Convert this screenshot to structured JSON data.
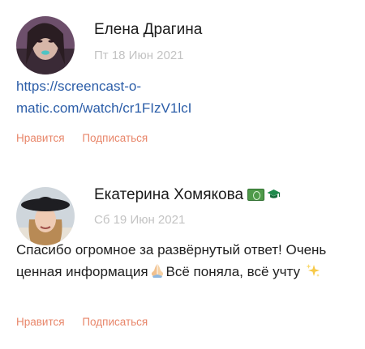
{
  "comments": [
    {
      "author": "Елена Драгина",
      "date": "Пт 18 Июн 2021",
      "text_lines": [
        "https://screencast-o-",
        "matic.com/watch/cr1FIzV1lcI"
      ],
      "like_label": "Нравится",
      "subscribe_label": "Подписаться"
    },
    {
      "author": "Екатерина Хомякова",
      "date": "Сб 19 Июн 2021",
      "text_part1": "Спасибо огромное за развёрнутый ответ! Очень ценная информация",
      "text_part2": "Всё поняла, всё учту",
      "like_label": "Нравится",
      "subscribe_label": "Подписаться"
    }
  ],
  "icons": {
    "money_badge": "money-badge-icon",
    "graduation_badge": "graduation-cap-icon",
    "pray_emoji": "folded-hands-icon",
    "sparkles_emoji": "sparkles-icon"
  },
  "colors": {
    "action": "#e8866a",
    "date": "#c3c3c3",
    "link": "#2b5da8"
  }
}
